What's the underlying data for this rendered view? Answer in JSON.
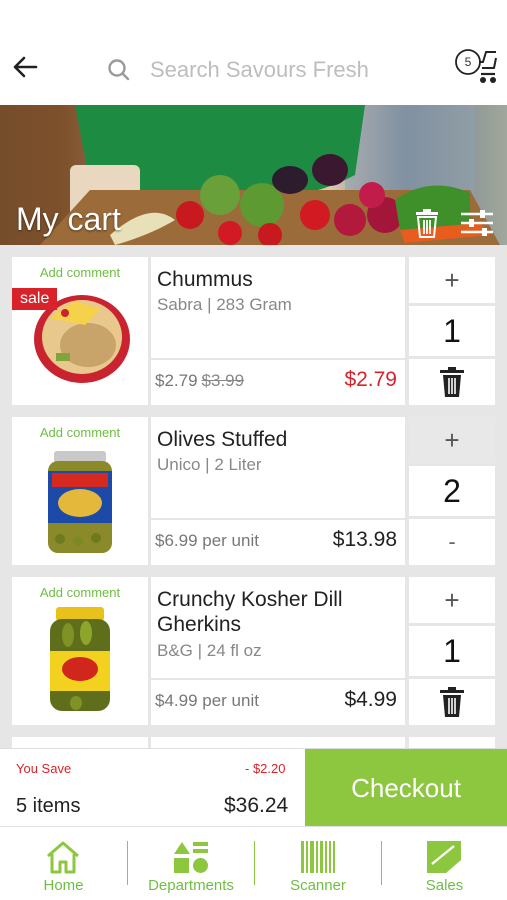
{
  "search": {
    "placeholder": "Search Savours Fresh"
  },
  "cart_badge": {
    "count": "5"
  },
  "banner": {
    "title": "My cart"
  },
  "items": [
    {
      "add_comment": "Add comment",
      "sale_badge": "sale",
      "name": "Chummus",
      "brand_size": "Sabra | 283 Gram",
      "unit_price": "$2.79",
      "old_price": "$3.99",
      "total": "$2.79",
      "quantity": "1",
      "plus": "+"
    },
    {
      "add_comment": "Add comment",
      "name": "Olives Stuffed",
      "brand_size": "Unico | 2 Liter",
      "unit_price": "$6.99 per unit",
      "total": "$13.98",
      "quantity": "2",
      "plus": "+",
      "minus": "-"
    },
    {
      "add_comment": "Add comment",
      "name": "Crunchy Kosher Dill Gherkins",
      "brand_size": "B&G | 24 fl oz",
      "unit_price": "$4.99 per unit",
      "total": "$4.99",
      "quantity": "1",
      "plus": "+"
    }
  ],
  "summary": {
    "you_save_label": "You Save",
    "you_save_amount": "- $2.20",
    "items_label": "5 items",
    "total": "$36.24",
    "checkout_label": "Checkout"
  },
  "nav": [
    {
      "label": "Home",
      "icon": "home-icon"
    },
    {
      "label": "Departments",
      "icon": "departments-icon"
    },
    {
      "label": "Scanner",
      "icon": "barcode-icon"
    },
    {
      "label": "Sales",
      "icon": "sale-tag-icon"
    }
  ],
  "colors": {
    "accent": "#8dc63f",
    "sale": "#d8232a",
    "label_green": "#6fbe44"
  }
}
